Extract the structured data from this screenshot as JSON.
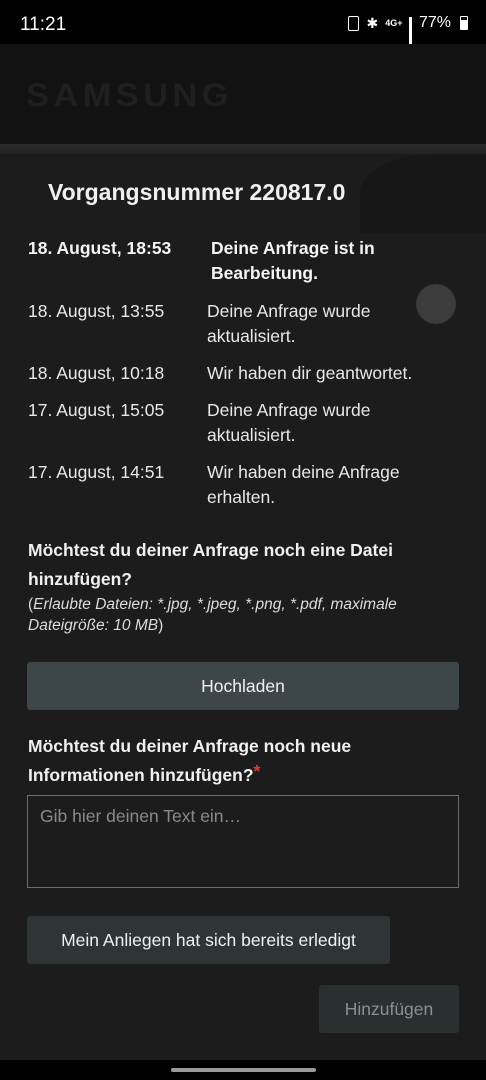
{
  "status_bar": {
    "time": "11:21",
    "network": "4G+",
    "battery": "77%",
    "icons": [
      "sim-icon",
      "bluetooth-icon",
      "network-4g-icon",
      "signal-icon",
      "battery-icon"
    ]
  },
  "header": {
    "logo": "SAMSUNG"
  },
  "case": {
    "title": "Vorgangsnummer 220817.0"
  },
  "history": [
    {
      "date": "18. August, 18:53",
      "text": "Deine Anfrage ist in Bearbeitung.",
      "bold": true
    },
    {
      "date": "18. August, 13:55",
      "text": "Deine Anfrage wurde aktualisiert.",
      "bold": false
    },
    {
      "date": "18. August, 10:18",
      "text": "Wir haben dir geantwortet.",
      "bold": false
    },
    {
      "date": "17. August, 15:05",
      "text": "Deine Anfrage wurde aktualisiert.",
      "bold": false
    },
    {
      "date": "17. August, 14:51",
      "text": "Wir haben deine Anfrage erhalten.",
      "bold": false
    }
  ],
  "upload": {
    "question": "Möchtest du deiner Anfrage noch eine Datei hinzufügen?",
    "hint": "Erlaubte Dateien: *.jpg, *.jpeg, *.png, *.pdf, maximale Dateigröße: 10 MB",
    "button_label": "Hochladen"
  },
  "info": {
    "question": "Möchtest du deiner Anfrage noch neue Informationen hinzufügen?",
    "required_mark": "*",
    "placeholder": "Gib hier deinen Text ein…",
    "value": ""
  },
  "actions": {
    "resolved_label": "Mein Anliegen hat sich bereits erledigt",
    "add_label": "Hinzufügen"
  },
  "colors": {
    "background": "#1c1c1c",
    "button_primary": "#3d4749",
    "button_secondary": "#2f3537",
    "required": "#e53935"
  }
}
